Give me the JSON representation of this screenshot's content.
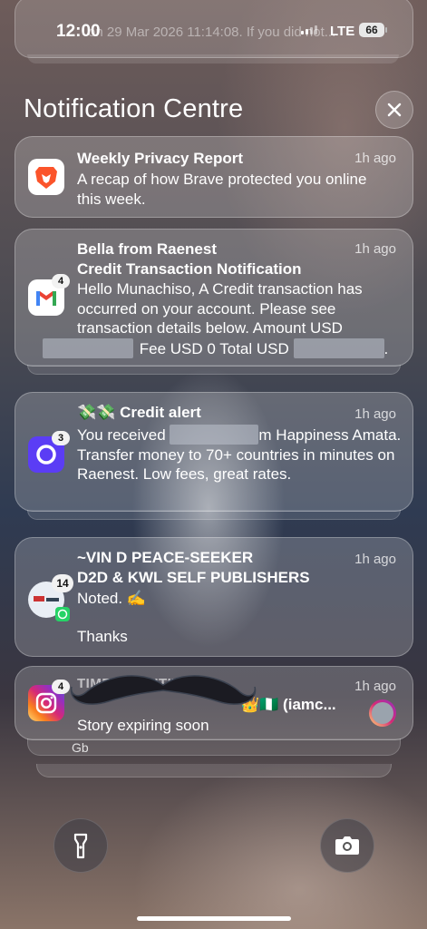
{
  "status_bar": {
    "time": "12:00",
    "network": "LTE",
    "battery": "66"
  },
  "previous_notification": {
    "snippet": "on 29 Mar 2026 11:14:08. If you did not..."
  },
  "notification_centre": {
    "title": "Notification Centre"
  },
  "notifications": [
    {
      "app": "Brave",
      "title": "Weekly Privacy Report",
      "time": "1h ago",
      "body": "A recap of how Brave protected you online this week."
    },
    {
      "app": "Gmail",
      "badge": "4",
      "sender": "Bella from Raenest",
      "title": "Credit Transaction Notification",
      "time": "1h ago",
      "body_line1": "Hello Munachiso, A Credit transaction has occurred on your account. Please see transaction details below. Amount USD",
      "body_line2": "Fee USD 0 Total USD",
      "body_end": "."
    },
    {
      "app": "Raenest",
      "badge": "3",
      "title_emoji": "💸💸",
      "title": "Credit alert",
      "time": "1h ago",
      "body_start": "You received",
      "body_rest": "m Happiness Amata. Transfer money to 70+ countries in minutes on Raenest. Low fees, great rates."
    },
    {
      "app": "WhatsApp",
      "badge": "14",
      "sender": "~VIN D PEACE-SEEKER",
      "title": "D2D & KWL SELF PUBLISHERS",
      "time": "1h ago",
      "body_line1": "Noted. ✍️",
      "body_line2": "Thanks"
    },
    {
      "app": "Instagram",
      "badge": "4",
      "label": "TIME SENSITIVE",
      "title_tail": "👑🇳🇬 (iamc...",
      "time": "1h ago",
      "body": "Story expiring soon"
    }
  ],
  "stacked_hint": "Gb",
  "colors": {
    "brave": "#fb542b",
    "gmail_red": "#ea4335",
    "raenest": "#5b3df5",
    "whatsapp": "#25d366",
    "instagram_start": "#feda75",
    "instagram_end": "#d62976"
  },
  "icons": {
    "close": "close-icon",
    "flashlight": "flashlight-icon",
    "camera": "camera-icon"
  }
}
